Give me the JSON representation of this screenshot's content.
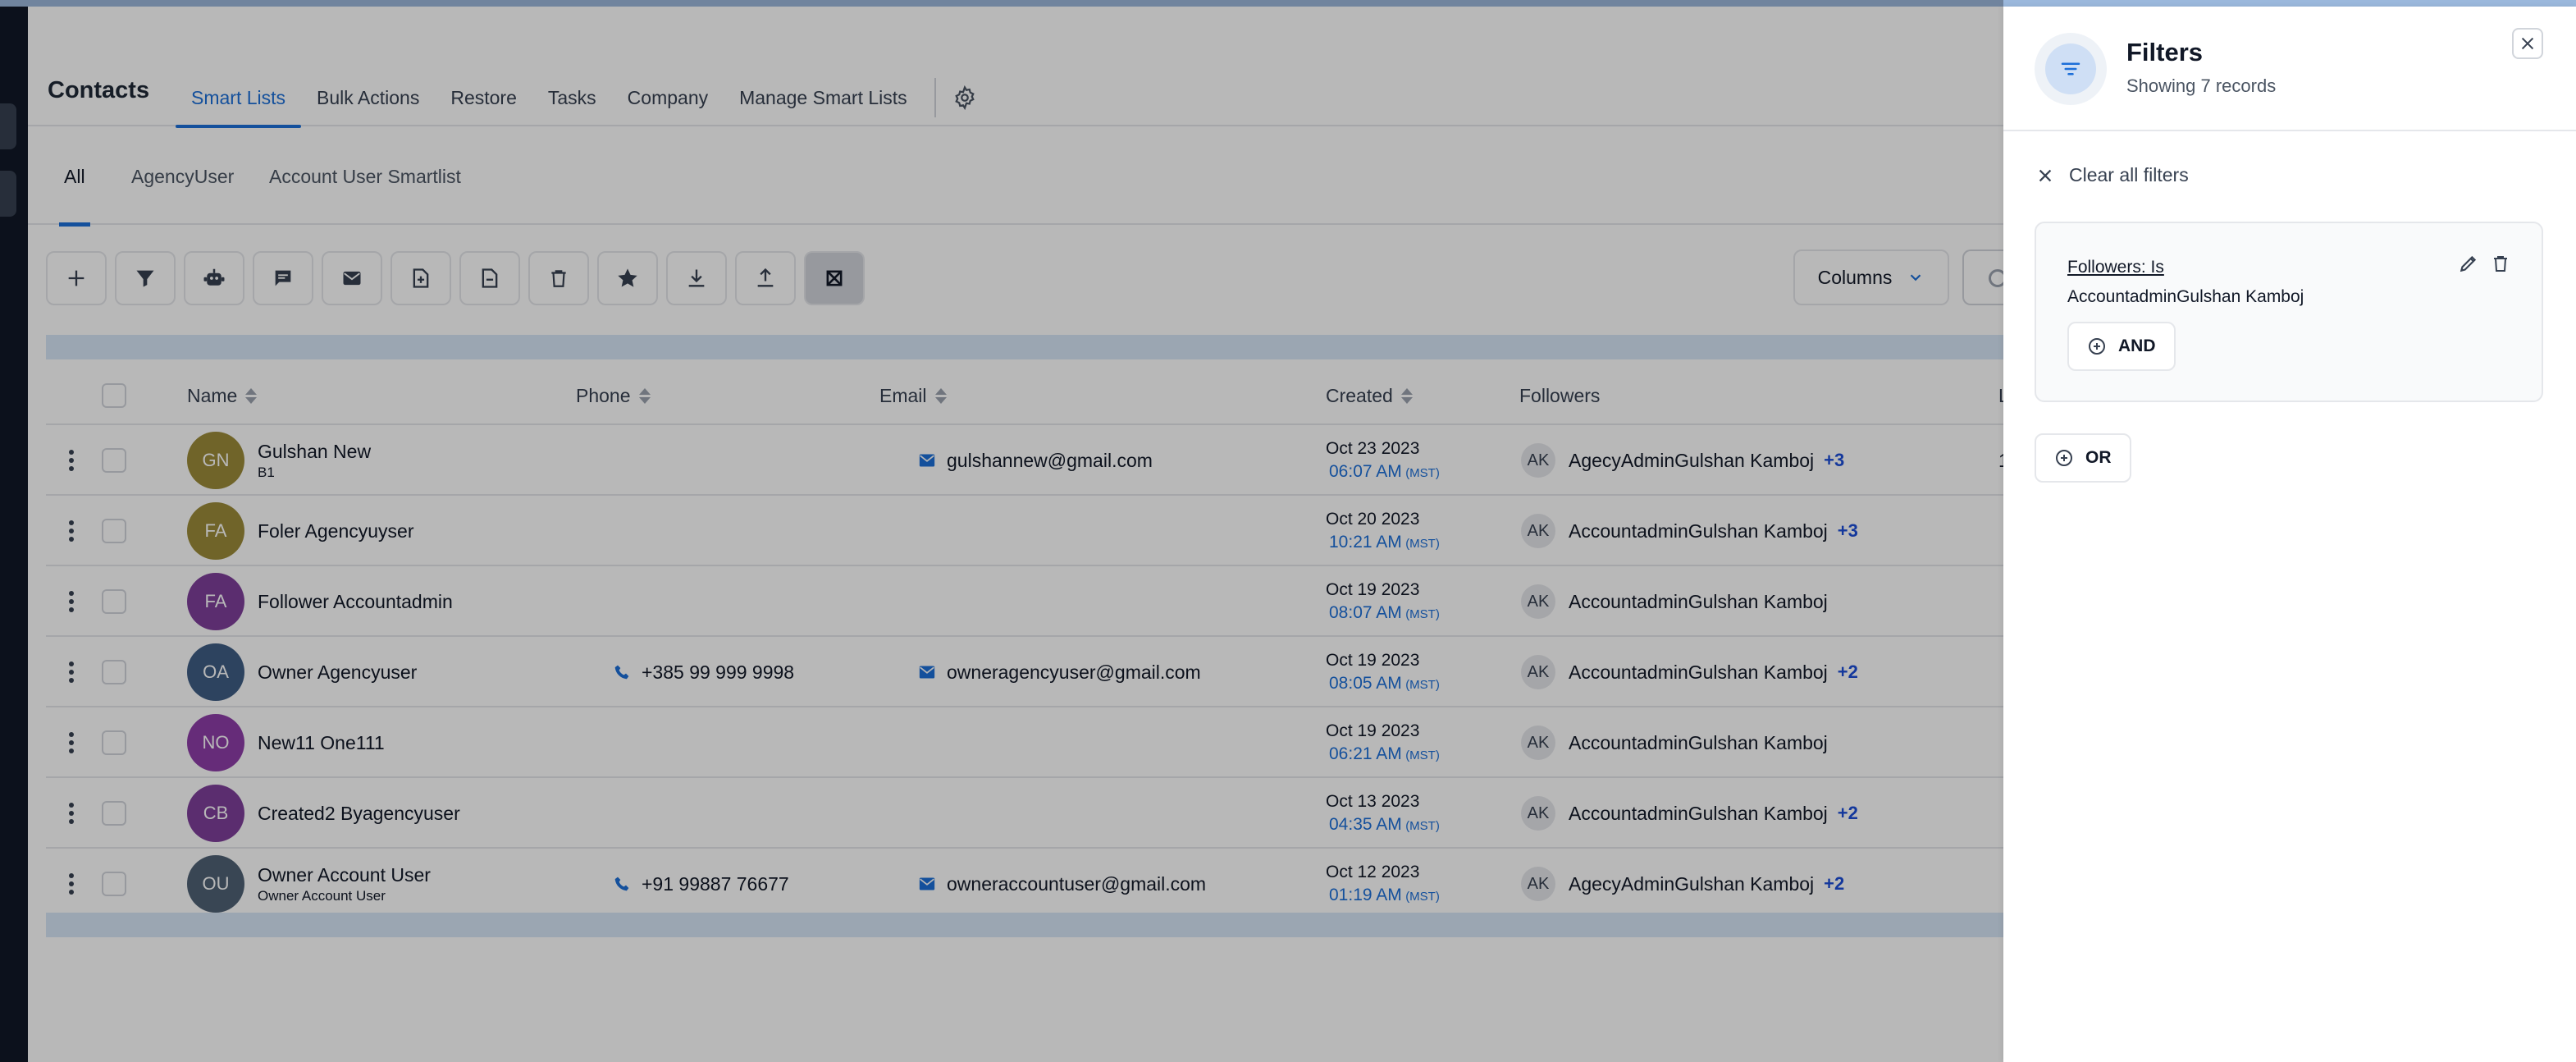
{
  "app": {
    "title": "Contacts"
  },
  "nav": {
    "items": [
      {
        "label": "Smart Lists",
        "active": true
      },
      {
        "label": "Bulk Actions"
      },
      {
        "label": "Restore"
      },
      {
        "label": "Tasks"
      },
      {
        "label": "Company"
      },
      {
        "label": "Manage Smart Lists"
      }
    ],
    "settings_icon": "gear-icon"
  },
  "tabs": [
    {
      "label": "All",
      "active": true
    },
    {
      "label": "AgencyUser"
    },
    {
      "label": "Account User Smartlist"
    }
  ],
  "toolbar": {
    "icons": [
      "plus-icon",
      "filter-icon",
      "robot-icon",
      "message-icon",
      "email-icon",
      "tag-add-icon",
      "tag-remove-icon",
      "trash-icon",
      "star-icon",
      "download-icon",
      "upload-icon",
      "merge-icon"
    ],
    "columns_label": "Columns"
  },
  "table": {
    "headers": {
      "name": "Name",
      "phone": "Phone",
      "email": "Email",
      "created": "Created",
      "followers": "Followers",
      "last": "L"
    },
    "rows": [
      {
        "initials": "GN",
        "avatar_color": "#9c8b3a",
        "name": "Gulshan New",
        "sub": "B1",
        "phone": "",
        "email": "gulshannew@gmail.com",
        "date": "Oct 23 2023",
        "time": "06:07 AM",
        "tz": "(MST)",
        "follower_initials": "AK",
        "follower": "AgecyAdminGulshan Kamboj",
        "plus": "+3",
        "last": "1"
      },
      {
        "initials": "FA",
        "avatar_color": "#9c8b3a",
        "name": "Foler Agencyuyser",
        "sub": "",
        "phone": "",
        "email": "",
        "date": "Oct 20 2023",
        "time": "10:21 AM",
        "tz": "(MST)",
        "follower_initials": "AK",
        "follower": "AccountadminGulshan Kamboj",
        "plus": "+3",
        "last": ""
      },
      {
        "initials": "FA",
        "avatar_color": "#7e3f9a",
        "name": "Follower Accountadmin",
        "sub": "",
        "phone": "",
        "email": "",
        "date": "Oct 19 2023",
        "time": "08:07 AM",
        "tz": "(MST)",
        "follower_initials": "AK",
        "follower": "AccountadminGulshan Kamboj",
        "plus": "",
        "last": ""
      },
      {
        "initials": "OA",
        "avatar_color": "#3f5d84",
        "name": "Owner Agencyuser",
        "sub": "",
        "phone": "+385 99 999 9998",
        "email": "owneragencyuser@gmail.com",
        "date": "Oct 19 2023",
        "time": "08:05 AM",
        "tz": "(MST)",
        "follower_initials": "AK",
        "follower": "AccountadminGulshan Kamboj",
        "plus": "+2",
        "last": ""
      },
      {
        "initials": "NO",
        "avatar_color": "#8e3ea8",
        "name": "New11 One111",
        "sub": "",
        "phone": "",
        "email": "",
        "date": "Oct 19 2023",
        "time": "06:21 AM",
        "tz": "(MST)",
        "follower_initials": "AK",
        "follower": "AccountadminGulshan Kamboj",
        "plus": "",
        "last": ""
      },
      {
        "initials": "CB",
        "avatar_color": "#7e3f9a",
        "name": "Created2 Byagencyuser",
        "sub": "",
        "phone": "",
        "email": "",
        "date": "Oct 13 2023",
        "time": "04:35 AM",
        "tz": "(MST)",
        "follower_initials": "AK",
        "follower": "AccountadminGulshan Kamboj",
        "plus": "+2",
        "last": ""
      },
      {
        "initials": "OU",
        "avatar_color": "#4f6275",
        "name": "Owner Account User",
        "sub": "Owner Account User",
        "phone": "+91 99887 76677",
        "email": "owneraccountuser@gmail.com",
        "date": "Oct 12 2023",
        "time": "01:19 AM",
        "tz": "(MST)",
        "follower_initials": "AK",
        "follower": "AgecyAdminGulshan Kamboj",
        "plus": "+2",
        "last": ""
      }
    ]
  },
  "filters": {
    "title": "Filters",
    "subtitle": "Showing 7 records",
    "clear_label": "Clear all filters",
    "condition": "Followers:  Is",
    "value": "AccountadminGulshan Kamboj",
    "and_label": "AND",
    "or_label": "OR"
  },
  "colors": {
    "accent": "#1d6fd8",
    "overlay": "rgba(0,0,0,0.28)"
  }
}
